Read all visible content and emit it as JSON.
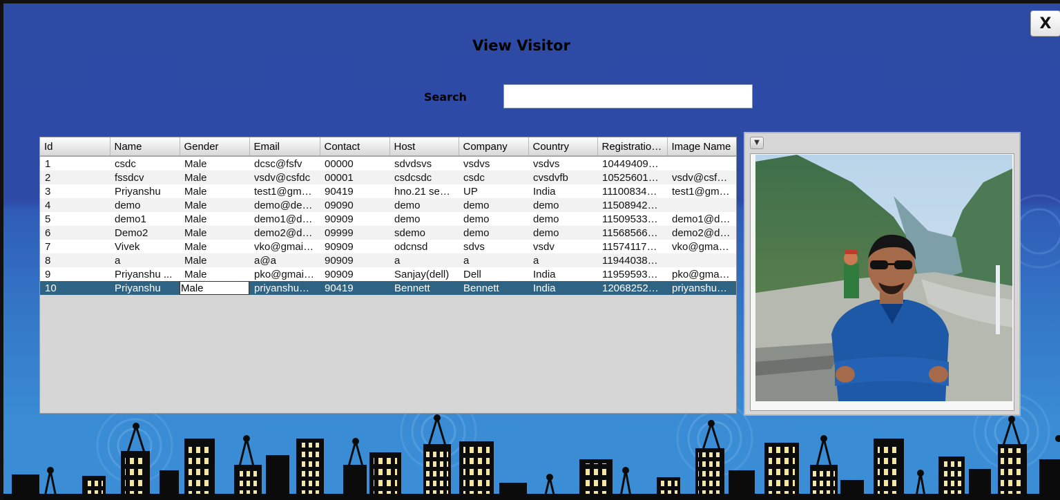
{
  "window": {
    "title": "View Visitor",
    "close_label": "X"
  },
  "search": {
    "label": "Search",
    "value": ""
  },
  "table": {
    "columns": [
      "Id",
      "Name",
      "Gender",
      "Email",
      "Contact",
      "Host",
      "Company",
      "Country",
      "Registration...",
      "Image Name"
    ],
    "rows": [
      [
        "1",
        "csdc",
        "Male",
        "dcsc@fsfv",
        "00000",
        "sdvdsvs",
        "vsdvs",
        "vsdvs",
        "1044940973...",
        ""
      ],
      [
        "2",
        "fssdcv",
        "Male",
        "vsdv@csfdc",
        "00001",
        "csdcsdc",
        "csdc",
        "cvsdvfb",
        "1052560161...",
        "vsdv@csfd..."
      ],
      [
        "3",
        "Priyanshu",
        "Male",
        "test1@gmai...",
        "90419",
        "hno.21 sect...",
        "UP",
        "India",
        "1110083457...",
        "test1@gmai..."
      ],
      [
        "4",
        "demo",
        "Male",
        "demo@demo",
        "09090",
        "demo",
        "demo",
        "demo",
        "1150894292...",
        ""
      ],
      [
        "5",
        "demo1",
        "Male",
        "demo1@de...",
        "90909",
        "demo",
        "demo",
        "demo",
        "1150953374...",
        "demo1@de..."
      ],
      [
        "6",
        "Demo2",
        "Male",
        "demo2@de...",
        "09999",
        "sdemo",
        "demo",
        "demo",
        "1156856611...",
        "demo2@de..."
      ],
      [
        "7",
        "Vivek",
        "Male",
        "vko@gmail....",
        "90909",
        "odcnsd",
        "sdvs",
        "vsdv",
        "1157411747...",
        "vko@gmail...."
      ],
      [
        "8",
        "a",
        "Male",
        "a@a",
        "90909",
        "a",
        "a",
        "a",
        "1194403844...",
        ""
      ],
      [
        "9",
        "Priyanshu ...",
        "Male",
        "pko@gmail....",
        "90909",
        "Sanjay(dell)",
        "Dell",
        "India",
        "1195959338...",
        "pko@gmail...."
      ],
      [
        "10",
        "Priyanshu",
        "Male",
        "priyanshuoj...",
        "90419",
        "Bennett",
        "Bennett",
        "India",
        "1206825231...",
        "priyanshuoj..."
      ]
    ],
    "selected_row_index": 9,
    "editing_column_index": 2
  },
  "image_panel": {
    "menu_icon": "chevron-down-icon"
  },
  "colors": {
    "background_top": "#2d4aa5",
    "background_bottom": "#3b8fd6",
    "selection": "#2f6383"
  }
}
